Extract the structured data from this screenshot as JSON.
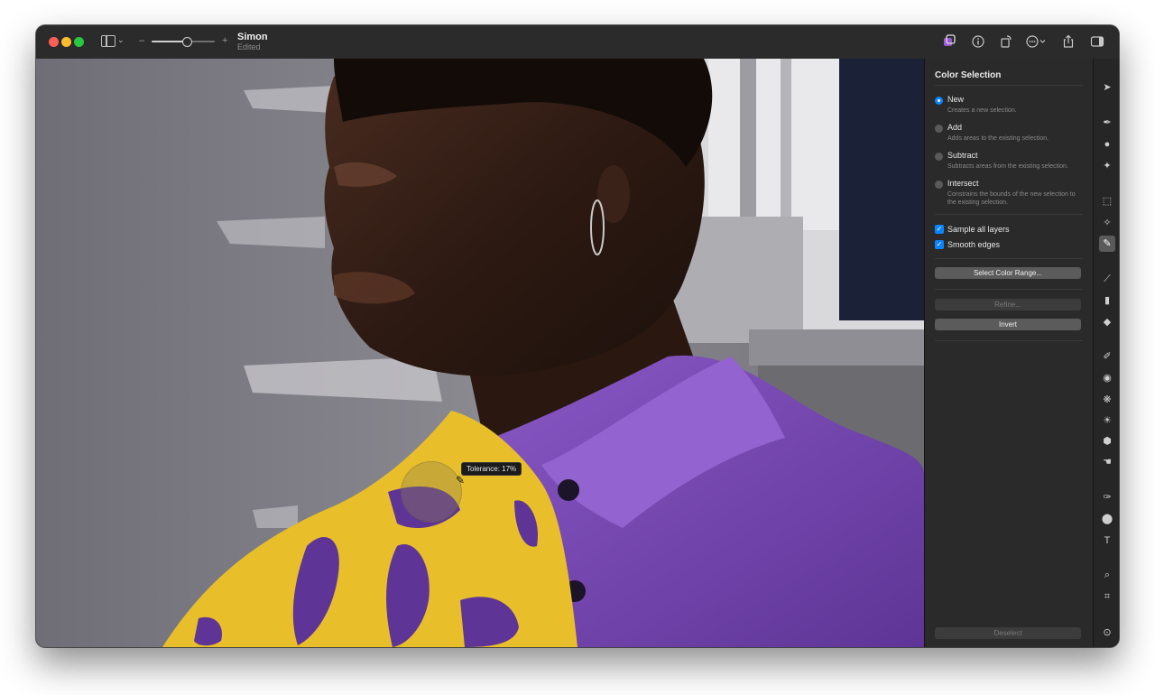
{
  "window": {
    "title": "Simon",
    "subtitle": "Edited"
  },
  "titlebar": {
    "zoom_minus": "–",
    "zoom_plus": "+",
    "zoom_level": 0.55,
    "right_icons": [
      "layers-icon",
      "info-icon",
      "rotate-icon",
      "more-icon",
      "share-icon",
      "sidebar-right-icon"
    ]
  },
  "canvas": {
    "tolerance_label": "Tolerance: 17%"
  },
  "panel": {
    "title": "Color Selection",
    "modes": [
      {
        "label": "New",
        "desc": "Creates a new selection.",
        "selected": true
      },
      {
        "label": "Add",
        "desc": "Adds areas to the existing selection.",
        "selected": false
      },
      {
        "label": "Subtract",
        "desc": "Subtracts areas from the existing selection.",
        "selected": false
      },
      {
        "label": "Intersect",
        "desc": "Constrains the bounds of the new selection to the existing selection.",
        "selected": false
      }
    ],
    "options": [
      {
        "label": "Sample all layers",
        "checked": true
      },
      {
        "label": "Smooth edges",
        "checked": true
      }
    ],
    "buttons": {
      "select_color_range": "Select Color Range...",
      "refine": "Refine...",
      "invert": "Invert",
      "deselect": "Deselect"
    }
  },
  "tools": [
    "arrow-icon",
    "paint-icon",
    "color-adjust-icon",
    "magic-icon",
    "marquee-icon",
    "quick-select-icon",
    "color-select-icon",
    "brush-icon",
    "fill-icon",
    "eraser-icon",
    "retouch-icon",
    "clone-icon",
    "blur-icon",
    "lighten-icon",
    "sponge-icon",
    "smudge-icon",
    "pen-icon",
    "shape-icon",
    "text-icon",
    "zoom-icon",
    "crop-icon",
    "more-tools-icon"
  ],
  "colors": {
    "accent": "#0a84ff",
    "shirt_purple": "#7e4fb8",
    "selection_yellow": "#e8bf2a"
  }
}
